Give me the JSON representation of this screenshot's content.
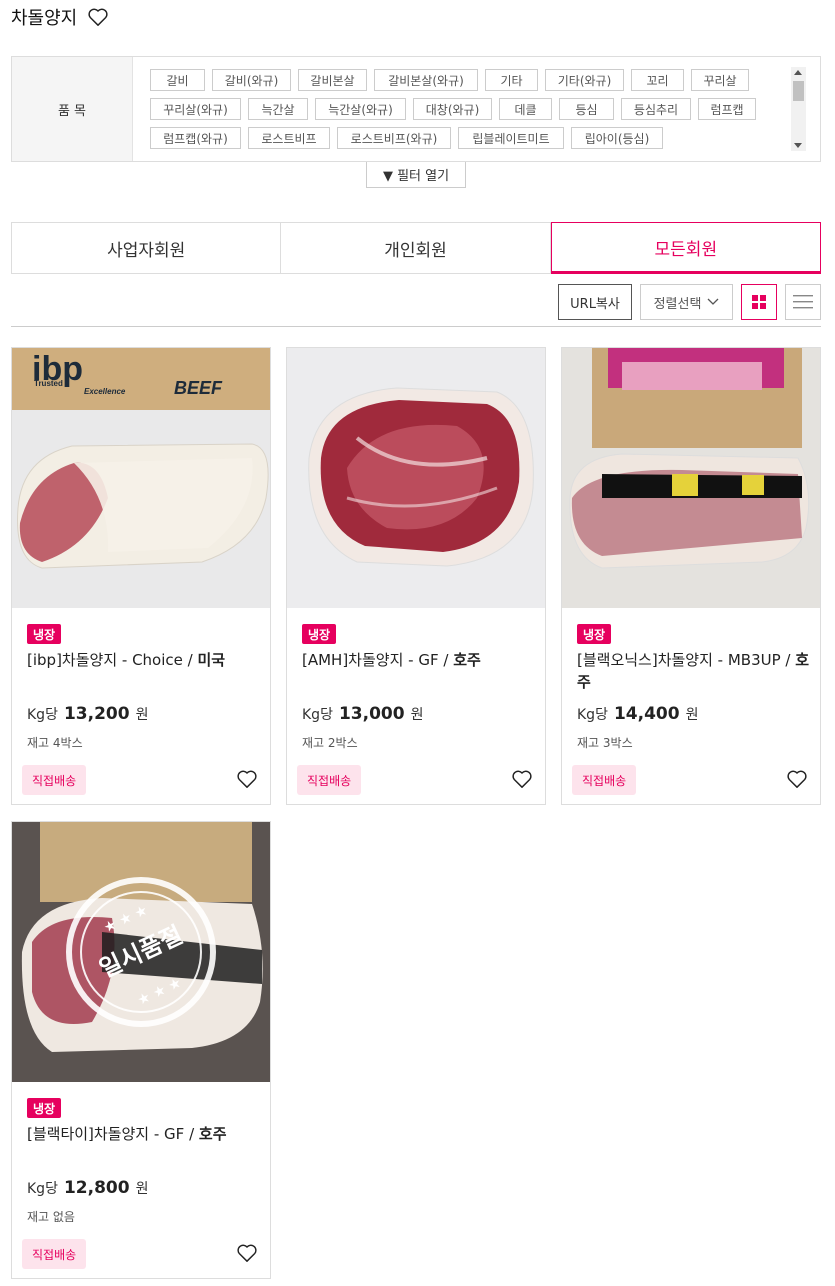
{
  "page": {
    "title": "차돌양지",
    "filter": {
      "label": "품 목",
      "chip_rows": [
        [
          "갈비",
          "갈비(와규)",
          "갈비본살",
          "갈비본살(와규)",
          "기타",
          "기타(와규)",
          "꼬리",
          "꾸리살"
        ],
        [
          "꾸리살(와규)",
          "늑간살",
          "늑간살(와규)",
          "대창(와규)",
          "데클",
          "등심",
          "등심추리",
          "럼프캡"
        ],
        [
          "럼프캡(와규)",
          "로스트비프",
          "로스트비프(와규)",
          "립블레이트미트",
          "립아이(등심)"
        ]
      ],
      "toggle_label": "▼ 필터 열기"
    },
    "tabs": [
      {
        "label": "사업자회원"
      },
      {
        "label": "개인회원"
      },
      {
        "label": "모든회원"
      }
    ],
    "tools": {
      "url_copy": "URL복사",
      "sort": "정렬선택"
    }
  },
  "products": [
    {
      "badge": "냉장",
      "brand": "[ibp]차돌양지",
      "grade": " - Choice / ",
      "origin": "미국",
      "unit": "Kg당",
      "price": "13,200",
      "won": "원",
      "stock": "재고 4박스",
      "delivery": "직접배송",
      "image_text": {
        "logo": "ibp",
        "line1": "Trusted",
        "line2": "Excellence",
        "beef": "BEEF"
      }
    },
    {
      "badge": "냉장",
      "brand": "[AMH]차돌양지",
      "grade": " - GF / ",
      "origin": "호주",
      "unit": "Kg당",
      "price": "13,000",
      "won": "원",
      "stock": "재고 2박스",
      "delivery": "직접배송"
    },
    {
      "badge": "냉장",
      "brand": "[블랙오닉스]차돌양지",
      "grade": " - MB3UP / ",
      "origin": "호주",
      "unit": "Kg당",
      "price": "14,400",
      "won": "원",
      "stock": "재고 3박스",
      "delivery": "직접배송"
    },
    {
      "badge": "냉장",
      "brand": "[블랙타이]차돌양지",
      "grade": " - GF / ",
      "origin": "호주",
      "unit": "Kg당",
      "price": "12,800",
      "won": "원",
      "stock": "재고 없음",
      "delivery": "직접배송",
      "image_text": {
        "stamp": "일시품절"
      }
    }
  ],
  "colors": {
    "accent": "#e6005e",
    "accent_light": "#fde3ec"
  }
}
